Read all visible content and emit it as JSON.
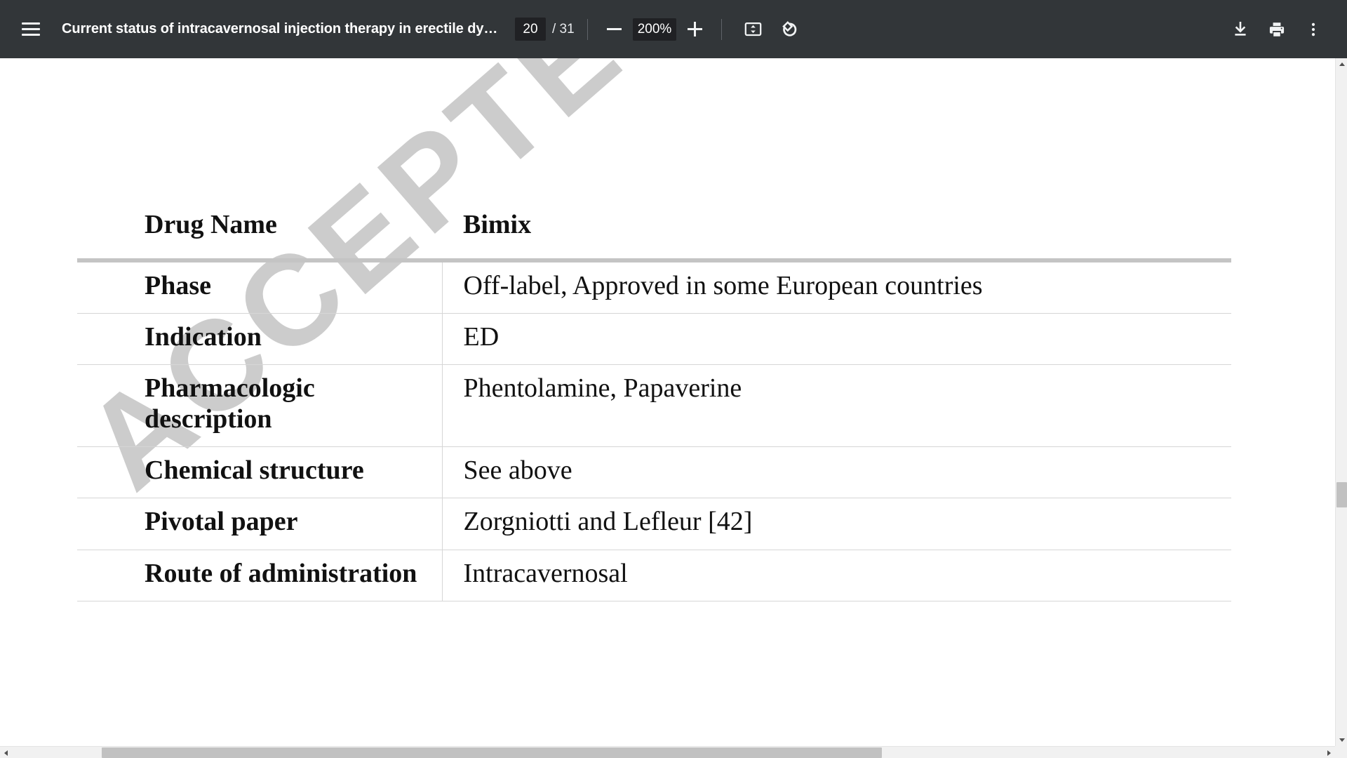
{
  "toolbar": {
    "menu_icon": "hamburger-menu-icon",
    "document_title": "Current status of intracavernosal injection therapy in erectile dy…",
    "page_current": "20",
    "page_count_label": "/ 31",
    "zoom_out_icon": "minus-icon",
    "zoom_level": "200%",
    "zoom_in_icon": "plus-icon",
    "fit_page_icon": "fit-to-page-icon",
    "rotate_icon": "rotate-counterclockwise-icon",
    "download_icon": "download-icon",
    "print_icon": "print-icon",
    "more_icon": "more-options-icon",
    "background_color": "#323639",
    "input_background_color": "#202124"
  },
  "document": {
    "watermark_text": "ACCEPTED MA",
    "watermark_color": "#cccccc",
    "table": {
      "header": {
        "label": "Drug Name",
        "value": "Bimix"
      },
      "rows": [
        {
          "label": "Phase",
          "value": "Off-label, Approved in some European countries"
        },
        {
          "label": "Indication",
          "value": "ED"
        },
        {
          "label": "Pharmacologic description",
          "value": "Phentolamine, Papaverine"
        },
        {
          "label": "Chemical structure",
          "value": "See above"
        },
        {
          "label": "Pivotal paper",
          "value": "Zorgniotti and Lefleur [42]"
        },
        {
          "label": "Route of administration",
          "value": "Intracavernosal"
        }
      ]
    }
  },
  "scrollbars": {
    "vertical_up_icon": "scroll-up-arrow-icon",
    "vertical_down_icon": "scroll-down-arrow-icon",
    "horizontal_left_icon": "scroll-left-arrow-icon",
    "horizontal_right_icon": "scroll-right-arrow-icon",
    "thumb_color": "#c1c1c1"
  }
}
